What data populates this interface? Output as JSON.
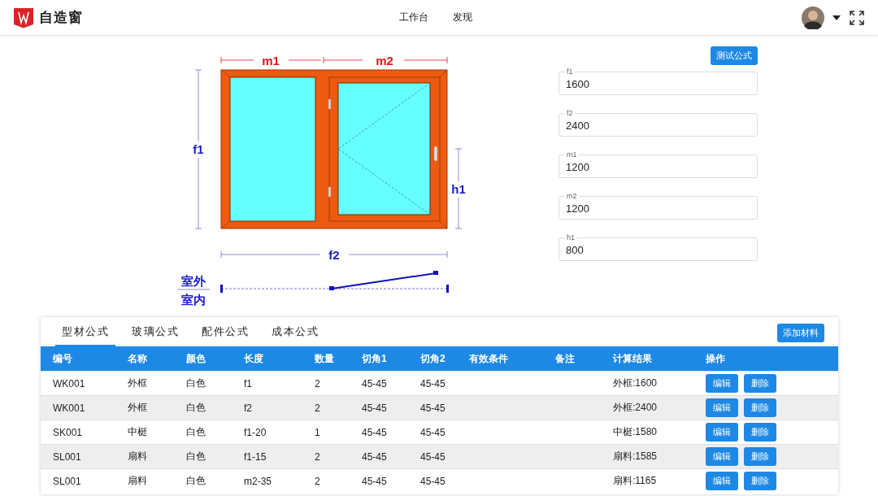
{
  "header": {
    "app_name": "自造窗",
    "nav": [
      {
        "label": "工作台"
      },
      {
        "label": "发现"
      }
    ]
  },
  "diagram": {
    "top": [
      "m1",
      "m2"
    ],
    "left": "f1",
    "right": "h1",
    "bottom": "f2",
    "outside": "室外",
    "inside": "室内"
  },
  "test_button": "测试公式",
  "fields": [
    {
      "label": "f1",
      "value": "1600"
    },
    {
      "label": "f2",
      "value": "2400"
    },
    {
      "label": "m1",
      "value": "1200"
    },
    {
      "label": "m2",
      "value": "1200"
    },
    {
      "label": "h1",
      "value": "800"
    }
  ],
  "tabs": [
    {
      "label": "型材公式",
      "selected": true
    },
    {
      "label": "玻璃公式",
      "selected": false
    },
    {
      "label": "配件公式",
      "selected": false
    },
    {
      "label": "成本公式",
      "selected": false
    }
  ],
  "add_button": "添加材料",
  "table": {
    "columns": [
      "编号",
      "名称",
      "颜色",
      "长度",
      "数量",
      "切角1",
      "切角2",
      "有效条件",
      "备注",
      "计算结果",
      "操作"
    ],
    "rows": [
      {
        "cells": [
          "WK001",
          "外框",
          "白色",
          "f1",
          "2",
          "45-45",
          "45-45",
          "",
          "",
          "外框:1600"
        ],
        "actions": [
          "编辑",
          "删除"
        ]
      },
      {
        "cells": [
          "WK001",
          "外框",
          "白色",
          "f2",
          "2",
          "45-45",
          "45-45",
          "",
          "",
          "外框:2400"
        ],
        "actions": [
          "编辑",
          "删除"
        ]
      },
      {
        "cells": [
          "SK001",
          "中梃",
          "白色",
          "f1-20",
          "1",
          "45-45",
          "45-45",
          "",
          "",
          "中梃:1580"
        ],
        "actions": [
          "编辑",
          "删除"
        ]
      },
      {
        "cells": [
          "SL001",
          "扇料",
          "白色",
          "f1-15",
          "2",
          "45-45",
          "45-45",
          "",
          "",
          "扇料:1585"
        ],
        "actions": [
          "编辑",
          "删除"
        ]
      },
      {
        "cells": [
          "SL001",
          "扇料",
          "白色",
          "m2-35",
          "2",
          "45-45",
          "45-45",
          "",
          "",
          "扇料:1165"
        ],
        "actions": [
          "编辑",
          "删除"
        ]
      }
    ]
  }
}
